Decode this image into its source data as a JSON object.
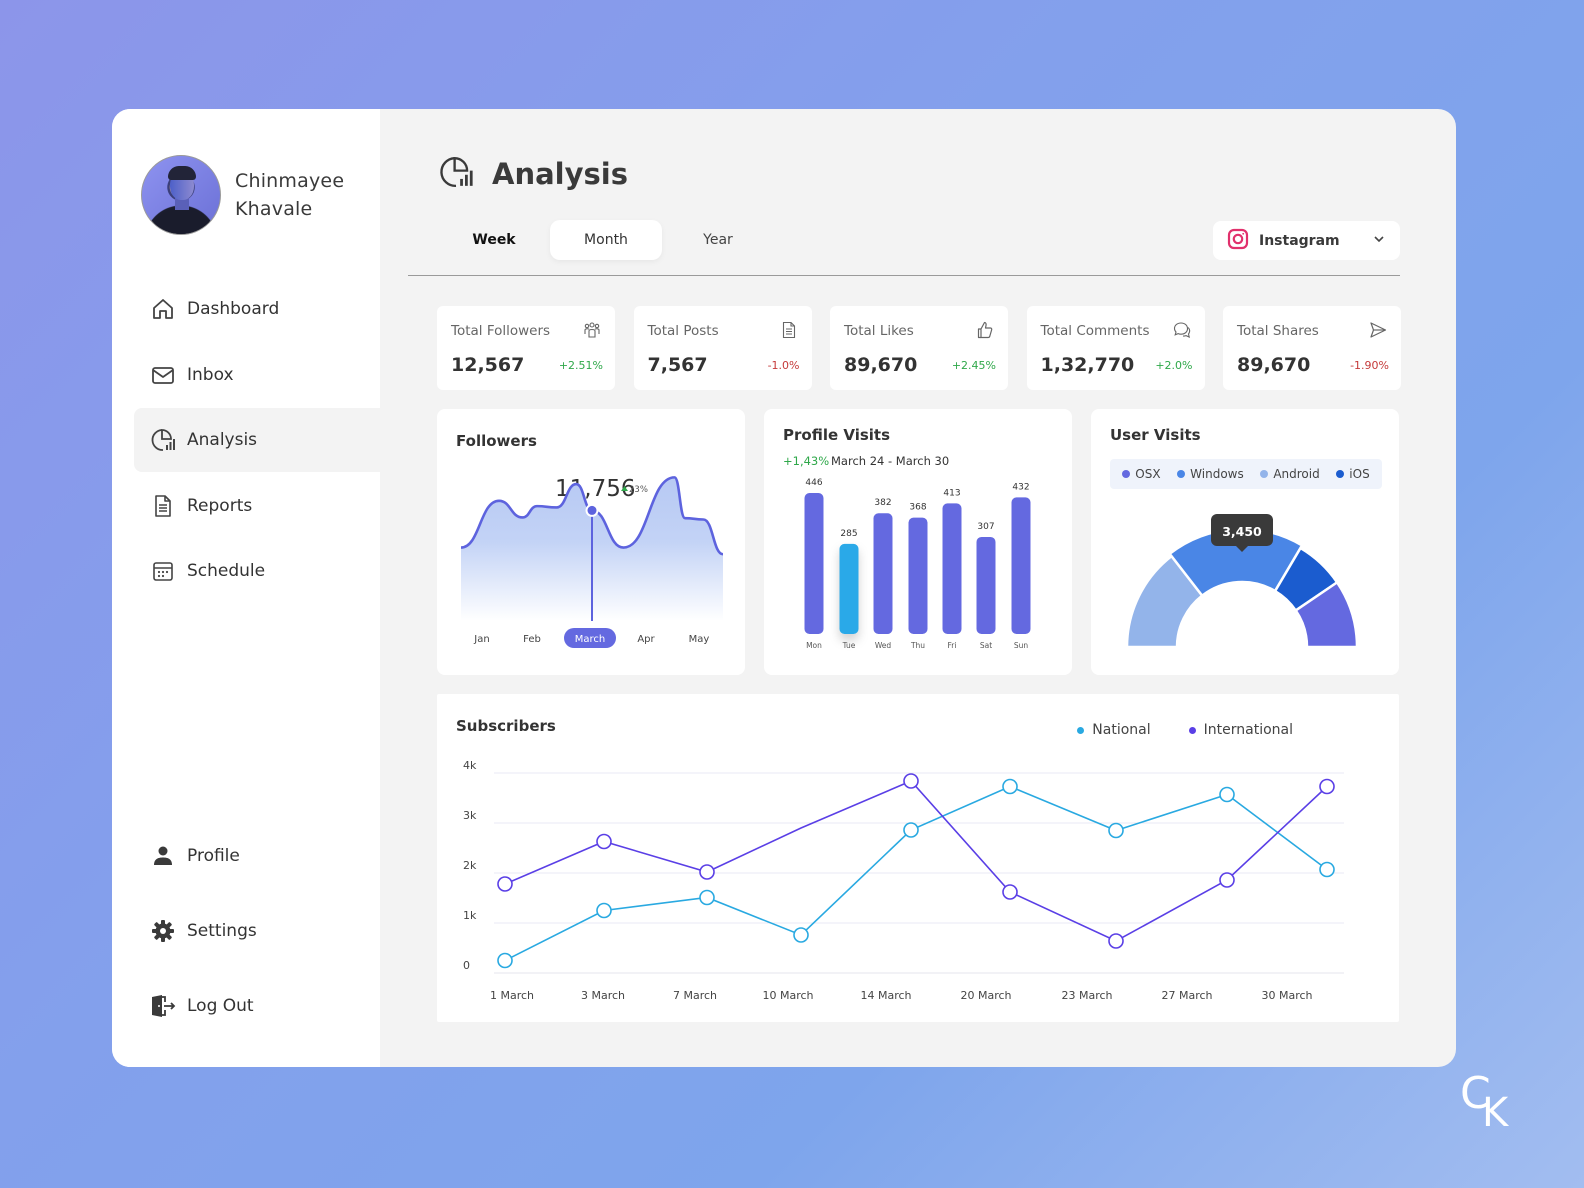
{
  "user": {
    "first_name": "Chinmayee",
    "last_name": "Khavale"
  },
  "sidebar": {
    "items": [
      {
        "label": "Dashboard",
        "icon": "home-icon"
      },
      {
        "label": "Inbox",
        "icon": "mail-icon"
      },
      {
        "label": "Analysis",
        "icon": "analysis-icon",
        "active": true
      },
      {
        "label": "Reports",
        "icon": "document-icon"
      },
      {
        "label": "Schedule",
        "icon": "calendar-icon"
      }
    ],
    "bottom_items": [
      {
        "label": "Profile",
        "icon": "user-icon"
      },
      {
        "label": "Settings",
        "icon": "gear-icon"
      },
      {
        "label": "Log Out",
        "icon": "logout-icon"
      }
    ]
  },
  "header": {
    "title": "Analysis",
    "tabs": [
      {
        "label": "Week"
      },
      {
        "label": "Month",
        "selected": true
      },
      {
        "label": "Year"
      }
    ],
    "platform_select": {
      "value": "Instagram",
      "icon": "instagram-icon"
    }
  },
  "stats": [
    {
      "label": "Total Followers",
      "value": "12,567",
      "change": "+2.51%",
      "trend": "up",
      "icon": "users-icon"
    },
    {
      "label": "Total Posts",
      "value": "7,567",
      "change": "-1.0%",
      "trend": "down",
      "icon": "document-icon"
    },
    {
      "label": "Total Likes",
      "value": "89,670",
      "change": "+2.45%",
      "trend": "up",
      "icon": "thumbs-up-icon"
    },
    {
      "label": "Total Comments",
      "value": "1,32,770",
      "change": "+2.0%",
      "trend": "up",
      "icon": "comments-icon"
    },
    {
      "label": "Total Shares",
      "value": "89,670",
      "change": "-1.90%",
      "trend": "down",
      "icon": "send-icon"
    }
  ],
  "colors": {
    "accent": "#6469e0",
    "highlight_bar": "#29a9e8",
    "positive": "#2fa84a",
    "negative": "#c53a3a",
    "national": "#29a9e1",
    "international": "#5a3fe6",
    "instagram": "#e1306c"
  },
  "chart_data": [
    {
      "type": "area",
      "title": "Followers",
      "highlight_value": "11,756",
      "highlight_change": "23%",
      "categories": [
        "Jan",
        "Feb",
        "March",
        "Apr",
        "May"
      ],
      "selected_category": "March",
      "values": [
        11200,
        11900,
        11650,
        11820,
        11800,
        12150,
        11756,
        11200,
        12250,
        11640,
        11620,
        11100
      ]
    },
    {
      "type": "bar",
      "title": "Profile Visits",
      "change": "+1,43%",
      "date_range": "March 24 - March 30",
      "categories": [
        "Mon",
        "Tue",
        "Wed",
        "Thu",
        "Fri",
        "Sat",
        "Sun"
      ],
      "values": [
        446,
        285,
        382,
        368,
        413,
        307,
        432
      ],
      "highlighted": "Tue"
    },
    {
      "type": "pie",
      "title": "User Visits",
      "legend": [
        "OSX",
        "Windows",
        "Android",
        "iOS"
      ],
      "legend_colors": [
        "#6469e0",
        "#4a86e6",
        "#93b4ea",
        "#1b5ccf"
      ],
      "segments": [
        {
          "name": "Android",
          "share": 0.29,
          "color": "#93b4ea"
        },
        {
          "name": "Windows",
          "share": 0.38,
          "color": "#4a86e6"
        },
        {
          "name": "iOS",
          "share": 0.14,
          "color": "#1b5ccf"
        },
        {
          "name": "OSX",
          "share": 0.19,
          "color": "#6469e0"
        }
      ],
      "tooltip": "3,450"
    },
    {
      "type": "line",
      "title": "Subscribers",
      "x": [
        "1 March",
        "3 March",
        "7 March",
        "10 March",
        "14 March",
        "20 March",
        "23 March",
        "27 March",
        "30 March"
      ],
      "yticks": [
        "0",
        "1k",
        "2k",
        "3k",
        "4k"
      ],
      "ylim": [
        0,
        4000
      ],
      "grid": true,
      "legend_position": "top-right",
      "series": [
        {
          "name": "National",
          "values": [
            250,
            1250,
            1510,
            760,
            2860,
            3730,
            2850,
            3570,
            2070
          ],
          "markers": [
            true,
            true,
            true,
            true,
            true,
            true,
            true,
            true,
            true
          ]
        },
        {
          "name": "International",
          "values": [
            1780,
            2630,
            2020,
            2900,
            3840,
            1620,
            640,
            1860,
            3730
          ],
          "markers": [
            true,
            true,
            true,
            false,
            true,
            true,
            true,
            true,
            true
          ]
        }
      ]
    }
  ],
  "watermark": "CK"
}
